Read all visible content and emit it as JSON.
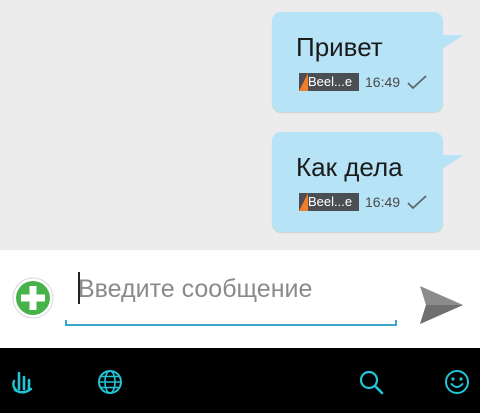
{
  "messages": [
    {
      "text": "Привет",
      "operator": "Beel...e",
      "time": "16:49",
      "status_icon": "check-icon"
    },
    {
      "text": "Как дела",
      "operator": "Beel...e",
      "time": "16:49",
      "status_icon": "check-icon"
    }
  ],
  "composer": {
    "placeholder": "Введите сообщение",
    "value": "",
    "add_icon": "plus-circle-icon",
    "send_icon": "send-icon"
  },
  "keyboard_bar": {
    "icons": [
      "touchpal-logo-icon",
      "globe-icon",
      "search-icon",
      "smiley-icon"
    ],
    "accent_color": "#20c6d6"
  },
  "colors": {
    "bubble": "#b7e3f7",
    "chat_background": "#ececec",
    "input_underline": "#37a8cc",
    "add_button": "#47b24a",
    "operator_badge": "#4b4e52",
    "operator_mark": "#f07c2c"
  }
}
